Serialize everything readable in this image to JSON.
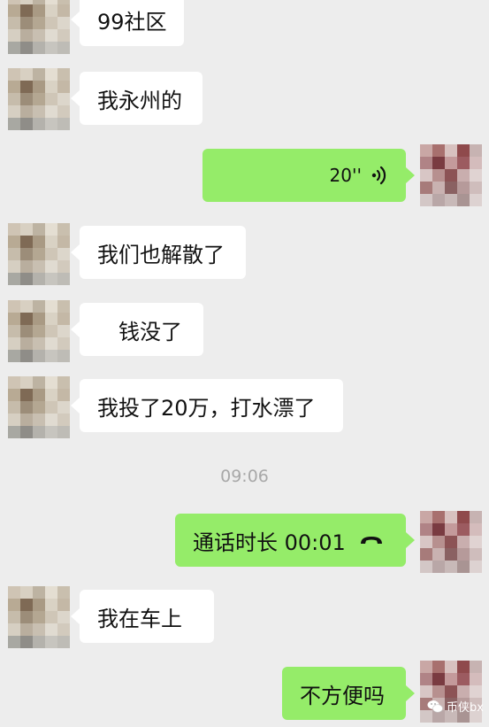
{
  "messages": {
    "m1": "99社区",
    "m2": "我永州的",
    "voice_duration": "20''",
    "m4": "我们也解散了",
    "m5": "钱没了",
    "m6": "我投了20万，打水漂了",
    "time": "09:06",
    "call": "通话时长 00:01",
    "m8": "我在车上",
    "m9": "不方便吗"
  },
  "watermark": {
    "text": "币侠bx",
    "icon": "wechat-icon"
  },
  "colors": {
    "background": "#ededed",
    "incoming_bubble": "#ffffff",
    "outgoing_bubble": "#95ec69"
  },
  "avatars": {
    "left": [
      "#cfc4b4",
      "#d8d0c2",
      "#bdb3a2",
      "#e4ded2",
      "#c9bfae",
      "#b8aa94",
      "#7f6a55",
      "#a99a84",
      "#d9d2c4",
      "#c4b8a6",
      "#c6bcab",
      "#9c8d79",
      "#b4a792",
      "#cfc6b7",
      "#dcd6cb",
      "#d6cfc2",
      "#b9ae9e",
      "#c8bfb1",
      "#e0dbd1",
      "#d2cabd",
      "#a8a8a2",
      "#8f8d88",
      "#b4b2ac",
      "#c7c5bf",
      "#bebcb6"
    ],
    "right": [
      "#c9a7a5",
      "#a8706e",
      "#d8c1bf",
      "#8f4a4c",
      "#c7b3b2",
      "#b08386",
      "#7a3b41",
      "#c49a9b",
      "#9c5b60",
      "#d4bcbc",
      "#d8c6c5",
      "#b7908f",
      "#8c5355",
      "#c9aeae",
      "#e0d3d2",
      "#a77b7a",
      "#c9b2b1",
      "#8a6162",
      "#b69a9a",
      "#cfbdbc",
      "#d3c7c6",
      "#b9a7a7",
      "#c8b9b8",
      "#a99493",
      "#ddd2d1"
    ]
  }
}
